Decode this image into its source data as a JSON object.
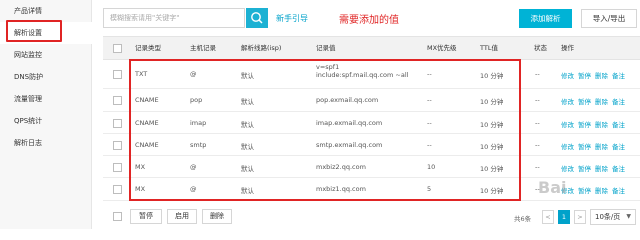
{
  "sidebar": {
    "items": [
      {
        "label": "产品详情"
      },
      {
        "label": "解析设置"
      },
      {
        "label": "网站监控"
      },
      {
        "label": "DNS防护"
      },
      {
        "label": "流量管理"
      },
      {
        "label": "QPS统计"
      },
      {
        "label": "解析日志"
      }
    ]
  },
  "toolbar": {
    "search_placeholder": "模糊搜索请用\"关键字\"",
    "guide_label": "新手引导",
    "callout": "需要添加的值",
    "add_label": "添加解析",
    "import_export_label": "导入/导出"
  },
  "table": {
    "headers": [
      "记录类型",
      "主机记录",
      "解析线路(isp)",
      "记录值",
      "MX优先级",
      "TTL值",
      "状态",
      "操作"
    ],
    "rows": [
      {
        "type": "TXT",
        "host": "@",
        "line": "默认",
        "value": "v=spf1 include:spf.mail.qq.com ~all",
        "mx": "--",
        "ttl": "10 分钟",
        "status": "--",
        "ops": [
          "修改",
          "暂停",
          "删除",
          "备注"
        ]
      },
      {
        "type": "CNAME",
        "host": "pop",
        "line": "默认",
        "value": "pop.exmail.qq.com",
        "mx": "--",
        "ttl": "10 分钟",
        "status": "--",
        "ops": [
          "修改",
          "暂停",
          "删除",
          "备注"
        ]
      },
      {
        "type": "CNAME",
        "host": "imap",
        "line": "默认",
        "value": "imap.exmail.qq.com",
        "mx": "--",
        "ttl": "10 分钟",
        "status": "--",
        "ops": [
          "修改",
          "暂停",
          "删除",
          "备注"
        ]
      },
      {
        "type": "CNAME",
        "host": "smtp",
        "line": "默认",
        "value": "smtp.exmail.qq.com",
        "mx": "--",
        "ttl": "10 分钟",
        "status": "--",
        "ops": [
          "修改",
          "暂停",
          "删除",
          "备注"
        ]
      },
      {
        "type": "MX",
        "host": "@",
        "line": "默认",
        "value": "mxbiz2.qq.com",
        "mx": "10",
        "ttl": "10 分钟",
        "status": "--",
        "ops": [
          "修改",
          "暂停",
          "删除",
          "备注"
        ]
      },
      {
        "type": "MX",
        "host": "@",
        "line": "默认",
        "value": "mxbiz1.qq.com",
        "mx": "5",
        "ttl": "10 分钟",
        "status": "--",
        "ops": [
          "修改",
          "暂停",
          "删除",
          "备注"
        ]
      }
    ]
  },
  "footer": {
    "pause_label": "暂停",
    "enable_label": "启用",
    "delete_label": "删除",
    "total_text": "共6条",
    "prev": "<",
    "page": "1",
    "next": ">",
    "page_size": "10条/页"
  },
  "watermark": "Bai"
}
